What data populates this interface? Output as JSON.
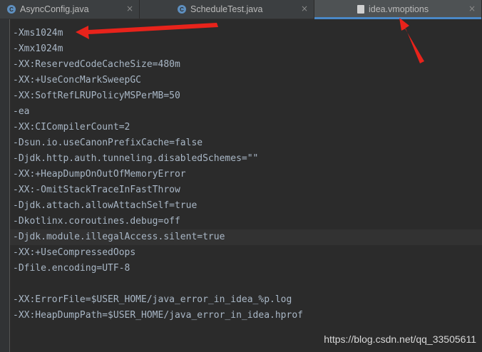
{
  "tabs": [
    {
      "label": "AsyncConfig.java",
      "close": "×"
    },
    {
      "label": "ScheduleTest.java",
      "close": "×"
    },
    {
      "label": "idea.vmoptions",
      "close": "×"
    }
  ],
  "lines": [
    "-Xms1024m",
    "-Xmx1024m",
    "-XX:ReservedCodeCacheSize=480m",
    "-XX:+UseConcMarkSweepGC",
    "-XX:SoftRefLRUPolicyMSPerMB=50",
    "-ea",
    "-XX:CICompilerCount=2",
    "-Dsun.io.useCanonPrefixCache=false",
    "-Djdk.http.auth.tunneling.disabledSchemes=\"\"",
    "-XX:+HeapDumpOnOutOfMemoryError",
    "-XX:-OmitStackTraceInFastThrow",
    "-Djdk.attach.allowAttachSelf=true",
    "-Dkotlinx.coroutines.debug=off",
    "-Djdk.module.illegalAccess.silent=true",
    "-XX:+UseCompressedOops",
    "-Dfile.encoding=UTF-8",
    "",
    "-XX:ErrorFile=$USER_HOME/java_error_in_idea_%p.log",
    "-XX:HeapDumpPath=$USER_HOME/java_error_in_idea.hprof"
  ],
  "current_line": 13,
  "watermark": "https://blog.csdn.net/qq_33505611",
  "colors": {
    "annotation": "#e8231b",
    "active_tab_underline": "#4a88c7"
  }
}
